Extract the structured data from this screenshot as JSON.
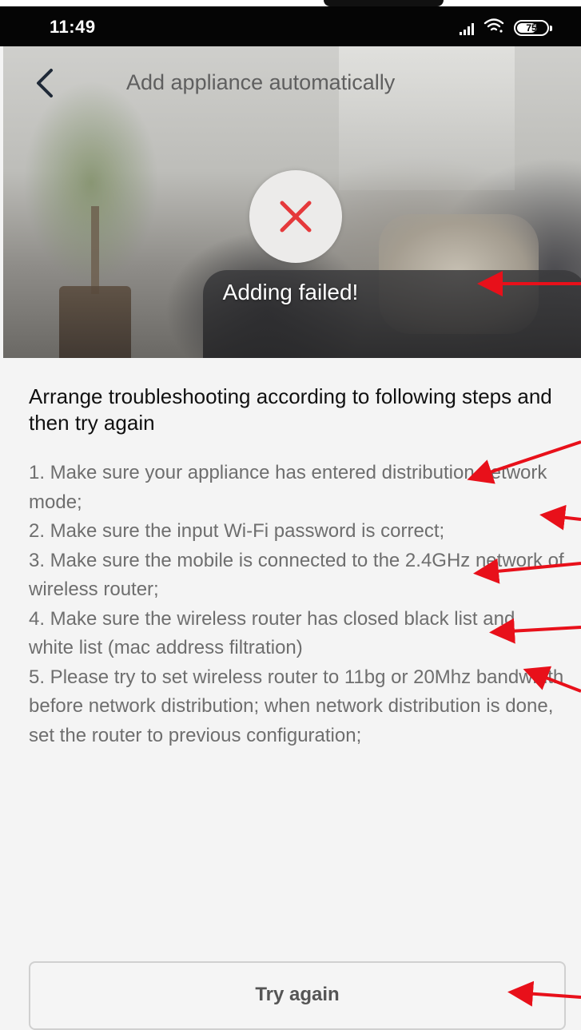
{
  "status_bar": {
    "time": "11:49",
    "battery": "75"
  },
  "header": {
    "title": "Add appliance automatically"
  },
  "result": {
    "message": "Adding failed!"
  },
  "content": {
    "heading": "Arrange troubleshooting according to following steps and then try again",
    "steps": [
      "1. Make sure your appliance has entered distribution network mode;",
      "2. Make sure the input Wi-Fi password is correct;",
      "3. Make sure the mobile is connected to the 2.4GHz network of wireless router;",
      "4. Make sure the wireless router has closed black list and white list (mac address filtration)",
      "5. Please try to set wireless router to 11bg or 20Mhz bandwidth before network distribution; when network distribution is done, set the router to previous configuration;"
    ]
  },
  "actions": {
    "try_again_label": "Try again"
  },
  "colors": {
    "fail_icon": "#e5393b",
    "annotation_arrow": "#e8101a",
    "step_text": "#6e6e6e"
  },
  "icons": {
    "back": "chevron-left-icon",
    "fail": "close-icon",
    "signal": "signal-icon",
    "wifi": "wifi-icon",
    "battery": "battery-icon"
  }
}
